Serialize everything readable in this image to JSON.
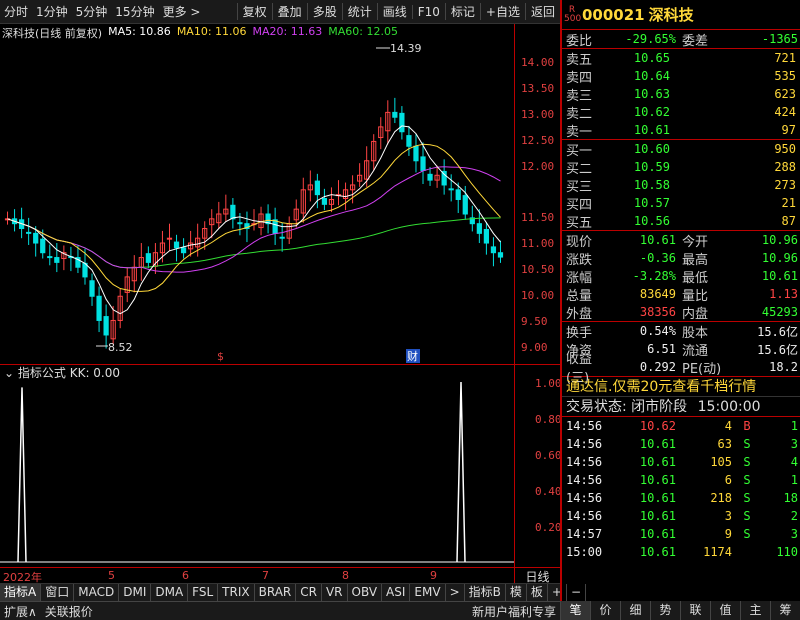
{
  "toolbar": {
    "left": [
      "分时",
      "1分钟",
      "5分钟",
      "15分钟",
      "更多 >"
    ],
    "right": [
      "复权",
      "叠加",
      "多股",
      "统计",
      "画线",
      "F10",
      "标记",
      "+自选",
      "返回"
    ]
  },
  "legend": {
    "title": "深科技(日线 前复权)",
    "ma5": "MA5: 10.86",
    "ma10": "MA10: 11.06",
    "ma20": "MA20: 11.63",
    "ma60": "MA60: 12.05"
  },
  "price_axis": [
    "14.00",
    "13.50",
    "13.00",
    "12.50",
    "12.00",
    "11.50",
    "11.00",
    "10.50",
    "10.00",
    "9.50",
    "9.00"
  ],
  "annotations": {
    "high": "14.39",
    "low": "8.52",
    "marker_s": "$",
    "marker_cai": "财"
  },
  "indicator": {
    "header": "指标公式 KK: 0.00",
    "axis": [
      "1.00",
      "0.80",
      "0.60",
      "0.40",
      "0.20"
    ]
  },
  "date_axis": {
    "year": "2022年",
    "months": [
      "5",
      "6",
      "7",
      "8",
      "9"
    ]
  },
  "period_label": "日线",
  "indicator_tabs": [
    "指标A",
    "窗口",
    "MACD",
    "DMI",
    "DMA",
    "FSL",
    "TRIX",
    "BRAR",
    "CR",
    "VR",
    "OBV",
    "ASI",
    "EMV",
    ">",
    "指标B",
    "模",
    "板",
    "+",
    "−"
  ],
  "status_bar": {
    "left": [
      "扩展∧",
      "关联报价"
    ],
    "right": "新用户福利专享"
  },
  "stock": {
    "badge": "R 500",
    "code": "000021",
    "name": "深科技"
  },
  "order_ratio": {
    "wb_label": "委比",
    "wb": "-29.65%",
    "wc_label": "委差",
    "wc": "-1365"
  },
  "sells": [
    {
      "label": "卖五",
      "price": "10.65",
      "vol": "721"
    },
    {
      "label": "卖四",
      "price": "10.64",
      "vol": "535"
    },
    {
      "label": "卖三",
      "price": "10.63",
      "vol": "623"
    },
    {
      "label": "卖二",
      "price": "10.62",
      "vol": "424"
    },
    {
      "label": "卖一",
      "price": "10.61",
      "vol": "97"
    }
  ],
  "buys": [
    {
      "label": "买一",
      "price": "10.60",
      "vol": "950"
    },
    {
      "label": "买二",
      "price": "10.59",
      "vol": "288"
    },
    {
      "label": "买三",
      "price": "10.58",
      "vol": "273"
    },
    {
      "label": "买四",
      "price": "10.57",
      "vol": "21"
    },
    {
      "label": "买五",
      "price": "10.56",
      "vol": "87"
    }
  ],
  "quote1": [
    {
      "l1": "现价",
      "v1": "10.61",
      "c1": "green",
      "l2": "今开",
      "v2": "10.96",
      "c2": "green"
    },
    {
      "l1": "涨跌",
      "v1": "-0.36",
      "c1": "green",
      "l2": "最高",
      "v2": "10.96",
      "c2": "green"
    },
    {
      "l1": "涨幅",
      "v1": "-3.28%",
      "c1": "green",
      "l2": "最低",
      "v2": "10.61",
      "c2": "green"
    },
    {
      "l1": "总量",
      "v1": "83649",
      "c1": "yellow",
      "l2": "量比",
      "v2": "1.13",
      "c2": "red"
    },
    {
      "l1": "外盘",
      "v1": "38356",
      "c1": "red",
      "l2": "内盘",
      "v2": "45293",
      "c2": "green"
    }
  ],
  "quote2": [
    {
      "l1": "换手",
      "v1": "0.54%",
      "l2": "股本",
      "v2": "15.6亿"
    },
    {
      "l1": "净资",
      "v1": "6.51",
      "l2": "流通",
      "v2": "15.6亿"
    },
    {
      "l1": "收益(三)",
      "v1": "0.292",
      "l2": "PE(动)",
      "v2": "18.2"
    }
  ],
  "promo": "通达信.仅需20元查看千档行情",
  "trade_state": {
    "label": "交易状态: 闭市阶段",
    "time": "15:00:00"
  },
  "ticks": [
    {
      "time": "14:56",
      "price": "10.62",
      "vol": "4",
      "bs": "B",
      "bsc": "red",
      "n": "1"
    },
    {
      "time": "14:56",
      "price": "10.61",
      "vol": "63",
      "bs": "S",
      "bsc": "green",
      "n": "3"
    },
    {
      "time": "14:56",
      "price": "10.61",
      "vol": "105",
      "bs": "S",
      "bsc": "green",
      "n": "4"
    },
    {
      "time": "14:56",
      "price": "10.61",
      "vol": "6",
      "bs": "S",
      "bsc": "green",
      "n": "1"
    },
    {
      "time": "14:56",
      "price": "10.61",
      "vol": "218",
      "bs": "S",
      "bsc": "green",
      "n": "18"
    },
    {
      "time": "14:56",
      "price": "10.61",
      "vol": "3",
      "bs": "S",
      "bsc": "green",
      "n": "2"
    },
    {
      "time": "14:57",
      "price": "10.61",
      "vol": "9",
      "bs": "S",
      "bsc": "green",
      "n": "3"
    },
    {
      "time": "15:00",
      "price": "10.61",
      "vol": "1174",
      "bs": "",
      "bsc": "purple",
      "n": "110"
    }
  ],
  "panel_tabs": [
    "笔",
    "价",
    "细",
    "势",
    "联",
    "值",
    "主",
    "筹"
  ],
  "colors": {
    "up": "#ff4444",
    "down": "#33ff33",
    "ma5": "#ffffff",
    "ma10": "#ffd83a",
    "ma20": "#d040f0",
    "ma60": "#33dd33",
    "axis": "#e04040"
  },
  "chart_data": {
    "type": "candlestick",
    "title": "深科技(日线 前复权)",
    "ylim": [
      8.4,
      14.6
    ],
    "x_months": [
      "5",
      "6",
      "7",
      "8",
      "9"
    ],
    "summary": {
      "period_high": 14.39,
      "period_low": 8.52,
      "last_close": 10.61
    },
    "close_path": [
      11.4,
      11.3,
      11.2,
      11.1,
      10.9,
      10.7,
      10.6,
      10.5,
      10.7,
      10.6,
      10.4,
      10.2,
      9.8,
      9.3,
      9.0,
      9.3,
      9.8,
      10.2,
      10.4,
      10.6,
      10.5,
      10.7,
      10.9,
      11.0,
      10.8,
      10.7,
      10.9,
      11.0,
      11.2,
      11.4,
      11.5,
      11.6,
      11.4,
      11.3,
      11.2,
      11.3,
      11.5,
      11.3,
      11.1,
      11.0,
      11.3,
      11.6,
      12.0,
      12.1,
      11.9,
      11.7,
      11.8,
      11.9,
      12.0,
      12.1,
      12.3,
      12.6,
      13.0,
      13.3,
      13.6,
      13.5,
      13.2,
      12.9,
      12.6,
      12.4,
      12.2,
      12.3,
      12.1,
      12.0,
      11.8,
      11.5,
      11.3,
      11.1,
      10.9,
      10.7,
      10.61
    ],
    "ma_labels": [
      "MA5: 10.86",
      "MA10: 11.06",
      "MA20: 11.63",
      "MA60: 12.05"
    ],
    "indicator_spikes": [
      0.97,
      1.0
    ]
  }
}
